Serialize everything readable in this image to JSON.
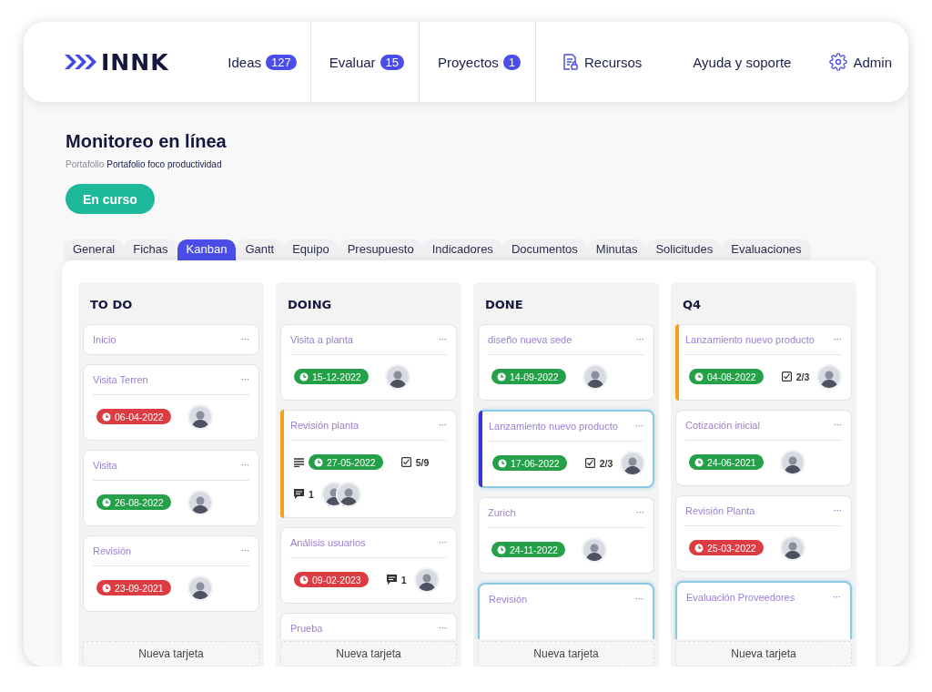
{
  "brand": {
    "name": "INNK"
  },
  "nav": [
    {
      "label": "Ideas",
      "kind": "count",
      "count": "127"
    },
    {
      "label": "Evaluar",
      "kind": "count",
      "count": "15"
    },
    {
      "label": "Proyectos",
      "kind": "count",
      "count": "1"
    },
    {
      "label": "Recursos",
      "kind": "resources"
    },
    {
      "label": "Ayuda y soporte",
      "kind": "plain"
    },
    {
      "label": "Admin",
      "kind": "settings"
    }
  ],
  "page": {
    "title": "Monitoreo en línea",
    "breadcrumb_label": "Portafolio",
    "breadcrumb_value": "Portafolio foco productividad",
    "status_button": "En curso"
  },
  "tabs": [
    {
      "label": "General",
      "selected": false
    },
    {
      "label": "Fichas",
      "selected": false
    },
    {
      "label": "Kanban",
      "selected": true
    },
    {
      "label": "Gantt",
      "selected": false
    },
    {
      "label": "Equipo",
      "selected": false
    },
    {
      "label": "Presupuesto",
      "selected": false
    },
    {
      "label": "Indicadores",
      "selected": false
    },
    {
      "label": "Documentos",
      "selected": false
    },
    {
      "label": "Minutas",
      "selected": false
    },
    {
      "label": "Solicitudes",
      "selected": false
    },
    {
      "label": "Evaluaciones",
      "selected": false
    }
  ],
  "columns": [
    {
      "name": "TO DO",
      "add_label": "Nueva tarjeta",
      "cards": [
        {
          "title": "Inicio",
          "menu": "···",
          "highlighted": false
        },
        {
          "title": "Visita Terren",
          "menu": "···",
          "highlighted": false,
          "rows": [
            [
              {
                "kind": "due",
                "date": "06-04-2022",
                "color": "#dd3b42"
              },
              {
                "kind": "people",
                "people": [
                  {
                    "kind": "photo"
                  }
                ]
              }
            ]
          ]
        },
        {
          "title": "Visita",
          "menu": "···",
          "highlighted": false,
          "rows": [
            [
              {
                "kind": "due",
                "date": "26-08-2022",
                "color": "#24a148"
              },
              {
                "kind": "people",
                "people": [
                  {
                    "kind": "photo"
                  }
                ]
              }
            ]
          ]
        },
        {
          "title": "Revisión",
          "menu": "···",
          "highlighted": false,
          "rows": [
            [
              {
                "kind": "due",
                "date": "23-09-2021",
                "color": "#dd3b42"
              },
              {
                "kind": "people",
                "people": [
                  {
                    "kind": "photo"
                  }
                ]
              }
            ]
          ]
        }
      ]
    },
    {
      "name": "DOING",
      "add_label": "Nueva tarjeta",
      "cards": [
        {
          "title": "Visita a planta",
          "menu": "···",
          "highlighted": false,
          "rows": [
            [
              {
                "kind": "due",
                "date": "15-12-2022",
                "color": "#24a148"
              },
              {
                "kind": "people",
                "people": [
                  {
                    "kind": "photo"
                  }
                ]
              }
            ]
          ]
        },
        {
          "title": "Revisión planta",
          "menu": "···",
          "highlighted": false,
          "color": "#f5a01a",
          "rows": [
            [
              {
                "kind": "description"
              },
              {
                "kind": "due",
                "date": "27-05-2022",
                "color": "#24a148"
              },
              {
                "kind": "checklist",
                "text": "5/9"
              }
            ],
            [
              {
                "kind": "comments",
                "text": "1"
              },
              {
                "kind": "people",
                "people": [
                  {
                    "kind": "photo"
                  },
                  {
                    "kind": "photo"
                  }
                ]
              }
            ]
          ]
        },
        {
          "title": "Análisis usuarios",
          "menu": "···",
          "highlighted": false,
          "rows": [
            [
              {
                "kind": "due",
                "date": "09-02-2023",
                "color": "#dd3b42"
              },
              {
                "kind": "comments",
                "text": "1"
              },
              {
                "kind": "people",
                "people": [
                  {
                    "kind": "photo"
                  }
                ]
              }
            ]
          ]
        },
        {
          "title": "Prueba",
          "menu": "···",
          "highlighted": false
        }
      ]
    },
    {
      "name": "DONE",
      "add_label": "Nueva tarjeta",
      "cards": [
        {
          "title": "diseño nueva sede",
          "menu": "···",
          "highlighted": false,
          "rows": [
            [
              {
                "kind": "due",
                "date": "14-09-2022",
                "color": "#24a148"
              },
              {
                "kind": "people",
                "people": [
                  {
                    "kind": "photo"
                  }
                ]
              }
            ]
          ]
        },
        {
          "title": "Lanzamiento nuevo producto",
          "menu": "···",
          "highlighted": true,
          "color": "#3b35d6",
          "rows": [
            [
              {
                "kind": "due",
                "date": "17-06-2022",
                "color": "#24a148"
              },
              {
                "kind": "checklist",
                "text": "2/3"
              },
              {
                "kind": "people",
                "people": [
                  {
                    "kind": "photo"
                  }
                ]
              }
            ]
          ]
        },
        {
          "title": "Zurich",
          "menu": "···",
          "highlighted": false,
          "rows": [
            [
              {
                "kind": "due",
                "date": "24-11-2022",
                "color": "#24a148"
              },
              {
                "kind": "people",
                "people": [
                  {
                    "kind": "photo"
                  }
                ]
              }
            ]
          ]
        },
        {
          "title": "Revisión",
          "menu": "···",
          "highlighted": true
        }
      ]
    },
    {
      "name": "Q4",
      "add_label": "Nueva tarjeta",
      "cards": [
        {
          "title": "Lanzamiento nuevo producto",
          "menu": "···",
          "highlighted": false,
          "color": "#f5a01a",
          "rows": [
            [
              {
                "kind": "due",
                "date": "04-08-2022",
                "color": "#24a148"
              },
              {
                "kind": "checklist",
                "text": "2/3"
              },
              {
                "kind": "people",
                "people": [
                  {
                    "kind": "photo"
                  }
                ]
              }
            ]
          ]
        },
        {
          "title": "Cotización inicial",
          "menu": "···",
          "highlighted": false,
          "rows": [
            [
              {
                "kind": "due",
                "date": "24-06-2021",
                "color": "#24a148"
              },
              {
                "kind": "people",
                "people": [
                  {
                    "kind": "photo"
                  }
                ]
              }
            ]
          ]
        },
        {
          "title": "Revisión Planta",
          "menu": "···",
          "highlighted": false,
          "rows": [
            [
              {
                "kind": "due",
                "date": "25-03-2022",
                "color": "#dd3b42"
              },
              {
                "kind": "people",
                "people": [
                  {
                    "kind": "photo"
                  }
                ]
              }
            ]
          ]
        },
        {
          "title": "Evaluación Proveedores",
          "menu": "···",
          "highlighted": true
        }
      ]
    }
  ]
}
